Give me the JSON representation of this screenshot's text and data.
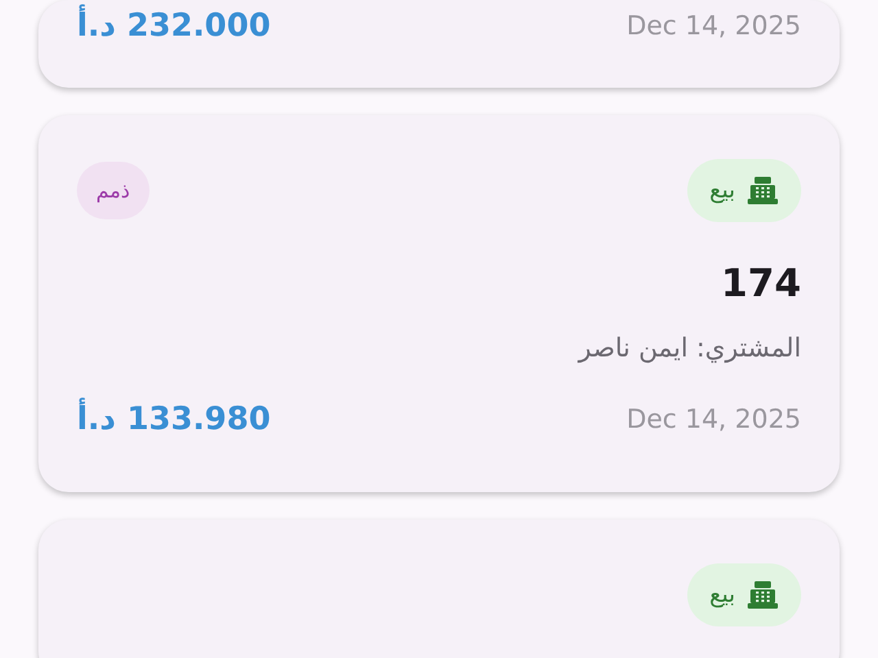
{
  "transactions": [
    {
      "kind": "partial",
      "amount": "232.000 د.أ",
      "date": "Dec 14, 2025"
    },
    {
      "kind": "full",
      "type": {
        "label": "بيع"
      },
      "status": {
        "label": "ذمم"
      },
      "number": "174",
      "buyer": "المشتري: ايمن ناصر",
      "amount": "133.980 د.أ",
      "date": "Dec 14, 2025"
    },
    {
      "kind": "header",
      "type": {
        "label": "بيع"
      }
    }
  ]
}
